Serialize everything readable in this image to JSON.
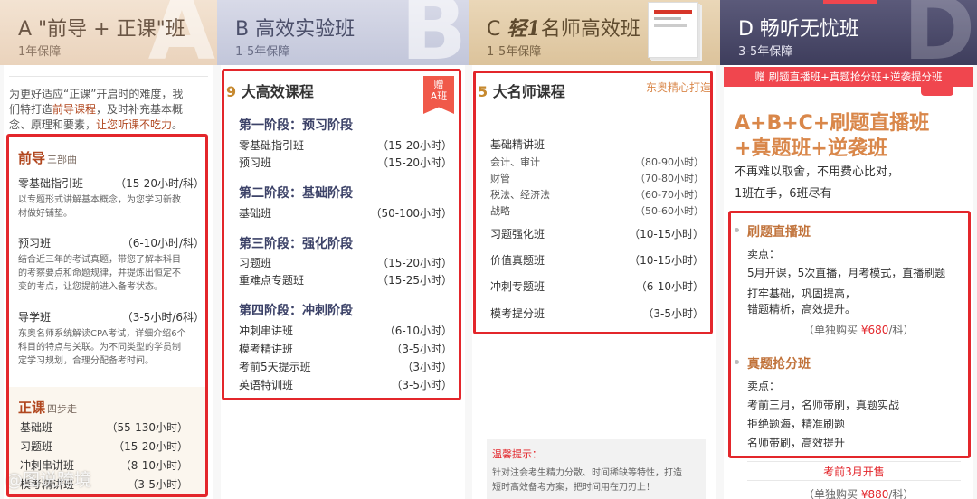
{
  "colA": {
    "title": "A \"前导 + 正课\"班",
    "subtitle": "1年保障",
    "letter": "A",
    "intro_1": "为更好适应“正课”开启时的难度，我",
    "intro_2a": "们特打造",
    "intro_2b": "前导课程",
    "intro_2c": "，及时补充基本概",
    "intro_3a": "念、原理和要素，",
    "intro_3b": "让您听课不吃力",
    "intro_3c": "。",
    "pre_title": "前导",
    "pre_sub": "三部曲",
    "pre_items": [
      {
        "name": "零基础指引班",
        "hours": "（15-20小时/科）",
        "desc1": "以专题形式讲解基本概念，为您学习新教",
        "desc2": "材做好铺垫。",
        "desc3": ""
      },
      {
        "name": "预习班",
        "hours": "（6-10小时/科）",
        "desc1": "结合近三年的考试真题，带您了解本科目",
        "desc2": "的考察要点和命题规律，并提炼出恒定不",
        "desc3": "变的考点，让您提前进入备考状态。"
      },
      {
        "name": "导学班",
        "hours": "（3-5小时/6科）",
        "desc1": "东奥名师系统解读CPA考试，详细介绍6个",
        "desc2": "科目的特点与关联。为不同类型的学员制",
        "desc3": "定学习规划，合理分配备考时间。"
      }
    ],
    "main_title": "正课",
    "main_sub": "四步走",
    "main_items": [
      {
        "name": "基础班",
        "hours": "（55-130小时）"
      },
      {
        "name": "习题班",
        "hours": "（15-20小时）"
      },
      {
        "name": "冲刺串讲班",
        "hours": "（8-10小时）"
      },
      {
        "name": "模考精讲班",
        "hours": "（3-5小时）"
      }
    ],
    "watermark": "@图说跨境"
  },
  "colB": {
    "title": "B 高效实验班",
    "subtitle": "1-5年保障",
    "letter": "B",
    "num": "9",
    "head": "大高效课程",
    "ribbon_1": "赠",
    "ribbon_2": "A班",
    "stages": [
      {
        "name": "第一阶段：预习阶段",
        "items": [
          {
            "name": "零基础指引班",
            "hours": "（15-20小时）"
          },
          {
            "name": "预习班",
            "hours": "（15-20小时）"
          }
        ]
      },
      {
        "name": "第二阶段：基础阶段",
        "items": [
          {
            "name": "基础班",
            "hours": "（50-100小时）"
          }
        ]
      },
      {
        "name": "第三阶段：强化阶段",
        "items": [
          {
            "name": "习题班",
            "hours": "（15-20小时）"
          },
          {
            "name": "重难点专题班",
            "hours": "（15-25小时）"
          }
        ]
      },
      {
        "name": "第四阶段：冲刺阶段",
        "items": [
          {
            "name": "冲刺串讲班",
            "hours": "（6-10小时）"
          },
          {
            "name": "模考精讲班",
            "hours": "（3-5小时）"
          },
          {
            "name": "考前5天提示班",
            "hours": "（3小时）"
          },
          {
            "name": "英语特训班",
            "hours": "（3-5小时）"
          }
        ]
      }
    ]
  },
  "colC": {
    "title_c": "C",
    "title_logo": "轻1",
    "title_rest": "名师高效班",
    "subtitle": "1-5年保障",
    "num": "5",
    "head": "大名师课程",
    "tag": "东奥精心打造",
    "basic": "基础精讲班",
    "basic_items": [
      {
        "name": "会计、审计",
        "hours": "（80-90小时）"
      },
      {
        "name": "财管",
        "hours": "（70-80小时）"
      },
      {
        "name": "税法、经济法",
        "hours": "（60-70小时）"
      },
      {
        "name": "战略",
        "hours": "（50-60小时）"
      }
    ],
    "items": [
      {
        "name": "习题强化班",
        "hours": "（10-15小时）"
      },
      {
        "name": "价值真题班",
        "hours": "（10-15小时）"
      },
      {
        "name": "冲刺专题班",
        "hours": "（6-10小时）"
      },
      {
        "name": "模考提分班",
        "hours": "（3-5小时）"
      }
    ],
    "tip_title": "温馨提示：",
    "tip_1": "针对注会考生精力分散、时间稀缺等特性，打造",
    "tip_2": "短时高效备考方案，把时间用在刀刃上！"
  },
  "colD": {
    "title": "D 畅听无忧班",
    "subtitle": "3-5年保障",
    "letter": "D",
    "gift": "赠 刷题直播班+真题抢分班+逆袭提分班",
    "big_1": "A+B+C+刷题直播班",
    "big_2": "+真题班+逆袭班",
    "line_1": "不再难以取舍，不用费心比对，",
    "line_2": "1班在手，6班尽有",
    "sec1_title": "刷题直播班",
    "sec1_label": "卖点：",
    "sec1_lines": [
      "5月开课，5次直播，月考模式，直播刷题",
      "打牢基础，巩固提高，",
      "错题精析，高效提升。"
    ],
    "sec1_price_pre": "（单独购买 ",
    "sec1_price": "¥680",
    "sec1_price_post": "/科）",
    "sec2_title": "真题抢分班",
    "sec2_label": "卖点：",
    "sec2_lines": [
      "考前三月，名师带刷，真题实战",
      "拒绝题海，精准刷题",
      "名师带刷，高效提升"
    ],
    "sec3_title": "考前3月开售",
    "sec3_price_pre": "（单独购买 ",
    "sec3_price": "¥880",
    "sec3_price_post": "/科）"
  },
  "colors": {
    "accent_red": "#e3262b",
    "orange": "#c1733b",
    "navy": "#3c4268"
  }
}
